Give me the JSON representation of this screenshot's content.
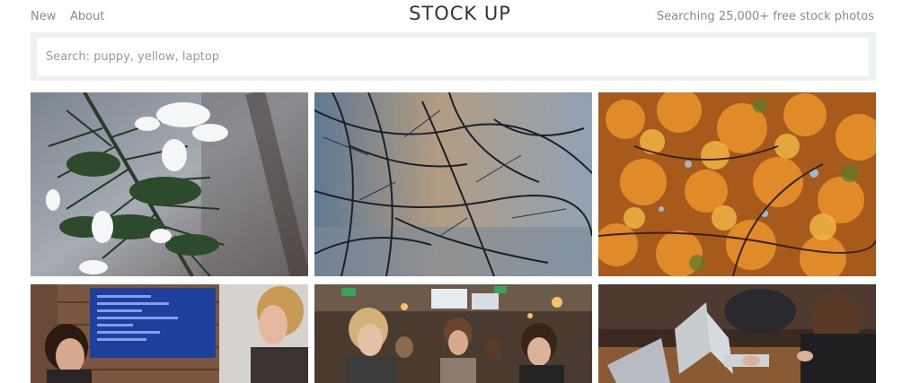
{
  "nav": {
    "new_label": "New",
    "about_label": "About"
  },
  "brand": {
    "title": "STOCK UP"
  },
  "tagline": "Searching 25,000+ free stock photos",
  "search": {
    "placeholder": "Search: puppy, yellow, laptop",
    "value": ""
  },
  "photos": [
    {
      "subject": "snowy-pine-branch"
    },
    {
      "subject": "icy-bare-branches"
    },
    {
      "subject": "autumn-leaves"
    },
    {
      "subject": "women-at-code-screen"
    },
    {
      "subject": "women-at-workshop-tables"
    },
    {
      "subject": "laptops-on-desk"
    }
  ],
  "colors": {
    "search_bg": "#eef1f4",
    "text_muted": "#8a8a8a",
    "brand_text": "#333333"
  }
}
